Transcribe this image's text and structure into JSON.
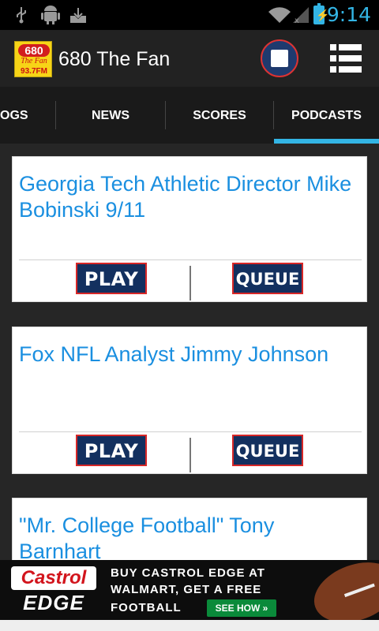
{
  "status_bar": {
    "time": "9:14",
    "icons": [
      "usb-icon",
      "android-debug-icon",
      "download-icon",
      "wifi-icon",
      "signal-icon",
      "battery-icon"
    ]
  },
  "action_bar": {
    "title": "680 The Fan",
    "logo": {
      "line1": "680",
      "line2": "The Fan",
      "line3": "93.7FM"
    },
    "stop_icon": "stop-icon",
    "list_icon": "list-icon"
  },
  "tabs": [
    {
      "label": "OGS"
    },
    {
      "label": "NEWS"
    },
    {
      "label": "SCORES"
    },
    {
      "label": "PODCASTS",
      "selected": true
    }
  ],
  "podcasts": [
    {
      "title": "Georgia Tech Athletic Director Mike Bobinski 9/11",
      "play_label": "PLAY",
      "queue_label": "QUEUE"
    },
    {
      "title": "Fox NFL Analyst Jimmy Johnson",
      "play_label": "PLAY",
      "queue_label": "QUEUE"
    },
    {
      "title": " \"Mr. College Football\" Tony Barnhart"
    }
  ],
  "ad": {
    "brand": "Castrol",
    "product": "EDGE",
    "line1": "BUY CASTROL EDGE AT",
    "line2": "WALMART, GET A FREE",
    "line3": "FOOTBALL",
    "cta": "SEE HOW »"
  },
  "colors": {
    "accent": "#33b5e5",
    "link": "#1a8fe0",
    "button_bg": "#13305f",
    "button_border": "#d72727"
  }
}
